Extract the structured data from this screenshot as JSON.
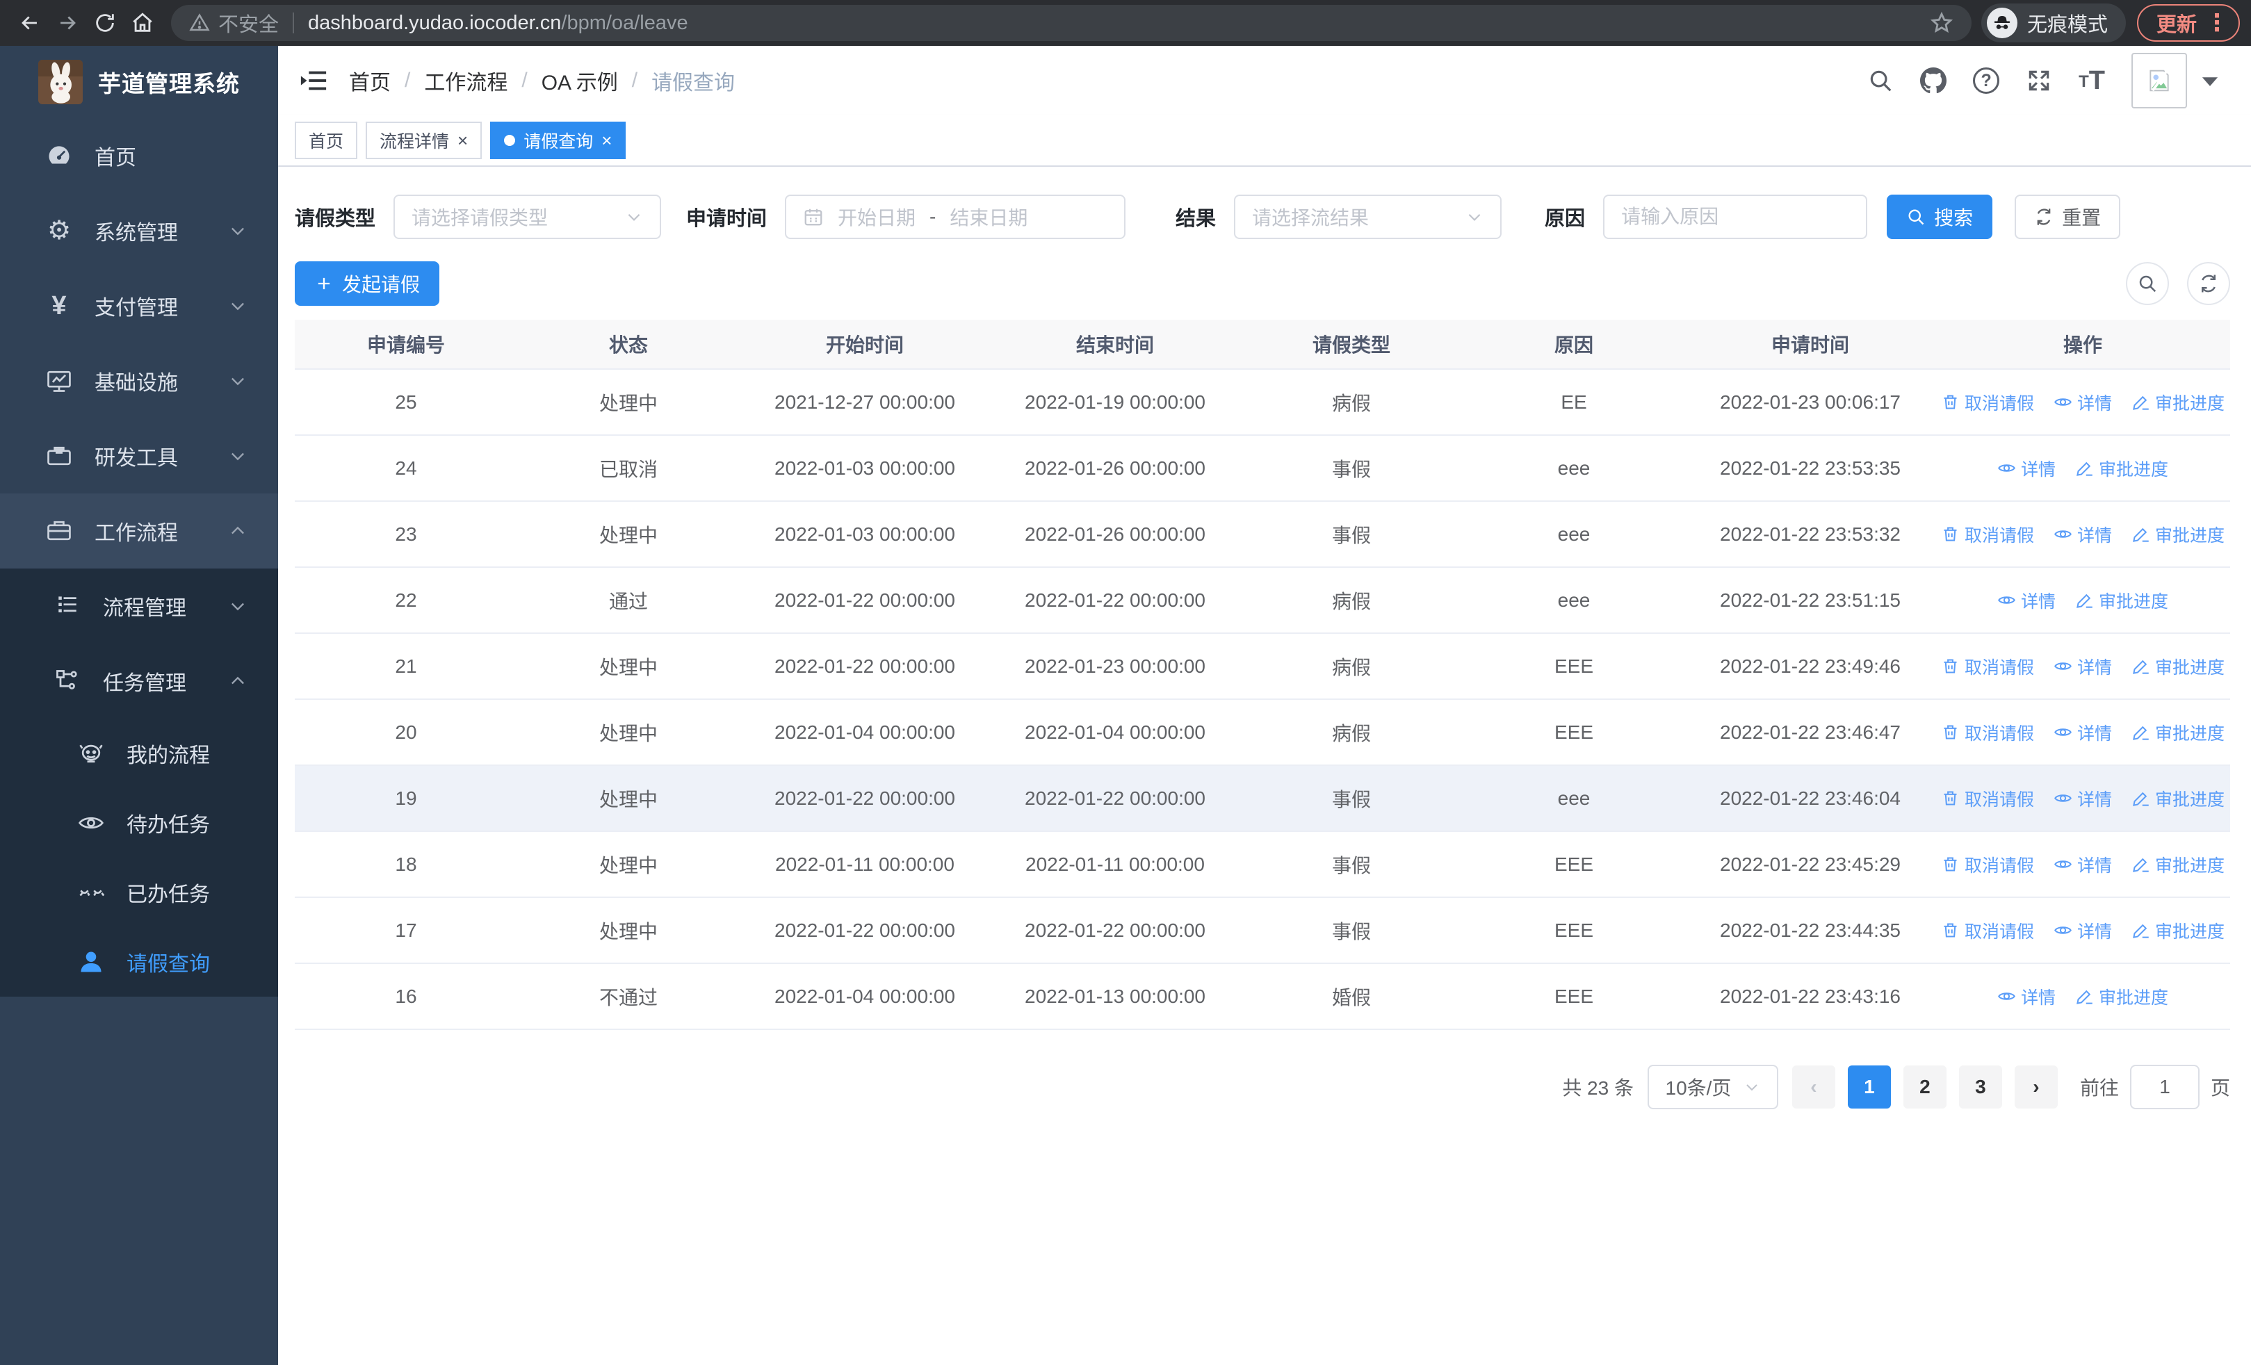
{
  "colors": {
    "accent": "#2d8cf0",
    "link": "#5b9df8",
    "sidebar_bg": "#304156",
    "submenu_bg": "#1f2d3d",
    "update_pill": "#f28b82",
    "table_header_bg": "#f8f8f9"
  },
  "browser": {
    "security": "不安全",
    "url_host": "dashboard.yudao.iocoder.cn",
    "url_path": "/bpm/oa/leave",
    "incognito": "无痕模式",
    "update": "更新"
  },
  "sidebar": {
    "title": "芋道管理系统",
    "items": [
      {
        "label": "首页"
      },
      {
        "label": "系统管理"
      },
      {
        "label": "支付管理"
      },
      {
        "label": "基础设施"
      },
      {
        "label": "研发工具"
      },
      {
        "label": "工作流程"
      }
    ],
    "sub": [
      {
        "label": "流程管理"
      },
      {
        "label": "任务管理"
      }
    ],
    "sub2": [
      {
        "label": "我的流程"
      },
      {
        "label": "待办任务"
      },
      {
        "label": "已办任务"
      },
      {
        "label": "请假查询"
      }
    ]
  },
  "breadcrumb": [
    "首页",
    "工作流程",
    "OA 示例",
    "请假查询"
  ],
  "tabs": [
    {
      "label": "首页"
    },
    {
      "label": "流程详情"
    },
    {
      "label": "请假查询"
    }
  ],
  "filters": {
    "leave_type_label": "请假类型",
    "leave_type_placeholder": "请选择请假类型",
    "apply_time_label": "申请时间",
    "date_start_placeholder": "开始日期",
    "date_separator": "-",
    "date_end_placeholder": "结束日期",
    "result_label": "结果",
    "result_placeholder": "请选择流结果",
    "reason_label": "原因",
    "reason_placeholder": "请输入原因",
    "search": "搜索",
    "reset": "重置"
  },
  "toolbar": {
    "create": "发起请假"
  },
  "table": {
    "headers": [
      "申请编号",
      "状态",
      "开始时间",
      "结束时间",
      "请假类型",
      "原因",
      "申请时间",
      "操作"
    ],
    "action_labels": {
      "cancel": "取消请假",
      "detail": "详情",
      "progress": "审批进度"
    },
    "rows": [
      {
        "id": "25",
        "status": "处理中",
        "start_time": "2021-12-27 00:00:00",
        "end_time": "2022-01-19 00:00:00",
        "leave_type": "病假",
        "reason": "EE",
        "apply_time": "2022-01-23 00:06:17",
        "actions": [
          "cancel",
          "detail",
          "progress"
        ],
        "highlighted": false
      },
      {
        "id": "24",
        "status": "已取消",
        "start_time": "2022-01-03 00:00:00",
        "end_time": "2022-01-26 00:00:00",
        "leave_type": "事假",
        "reason": "eee",
        "apply_time": "2022-01-22 23:53:35",
        "actions": [
          "detail",
          "progress"
        ],
        "highlighted": false
      },
      {
        "id": "23",
        "status": "处理中",
        "start_time": "2022-01-03 00:00:00",
        "end_time": "2022-01-26 00:00:00",
        "leave_type": "事假",
        "reason": "eee",
        "apply_time": "2022-01-22 23:53:32",
        "actions": [
          "cancel",
          "detail",
          "progress"
        ],
        "highlighted": false
      },
      {
        "id": "22",
        "status": "通过",
        "start_time": "2022-01-22 00:00:00",
        "end_time": "2022-01-22 00:00:00",
        "leave_type": "病假",
        "reason": "eee",
        "apply_time": "2022-01-22 23:51:15",
        "actions": [
          "detail",
          "progress"
        ],
        "highlighted": false
      },
      {
        "id": "21",
        "status": "处理中",
        "start_time": "2022-01-22 00:00:00",
        "end_time": "2022-01-23 00:00:00",
        "leave_type": "病假",
        "reason": "EEE",
        "apply_time": "2022-01-22 23:49:46",
        "actions": [
          "cancel",
          "detail",
          "progress"
        ],
        "highlighted": false
      },
      {
        "id": "20",
        "status": "处理中",
        "start_time": "2022-01-04 00:00:00",
        "end_time": "2022-01-04 00:00:00",
        "leave_type": "病假",
        "reason": "EEE",
        "apply_time": "2022-01-22 23:46:47",
        "actions": [
          "cancel",
          "detail",
          "progress"
        ],
        "highlighted": false
      },
      {
        "id": "19",
        "status": "处理中",
        "start_time": "2022-01-22 00:00:00",
        "end_time": "2022-01-22 00:00:00",
        "leave_type": "事假",
        "reason": "eee",
        "apply_time": "2022-01-22 23:46:04",
        "actions": [
          "cancel",
          "detail",
          "progress"
        ],
        "highlighted": true
      },
      {
        "id": "18",
        "status": "处理中",
        "start_time": "2022-01-11 00:00:00",
        "end_time": "2022-01-11 00:00:00",
        "leave_type": "事假",
        "reason": "EEE",
        "apply_time": "2022-01-22 23:45:29",
        "actions": [
          "cancel",
          "detail",
          "progress"
        ],
        "highlighted": false
      },
      {
        "id": "17",
        "status": "处理中",
        "start_time": "2022-01-22 00:00:00",
        "end_time": "2022-01-22 00:00:00",
        "leave_type": "事假",
        "reason": "EEE",
        "apply_time": "2022-01-22 23:44:35",
        "actions": [
          "cancel",
          "detail",
          "progress"
        ],
        "highlighted": false
      },
      {
        "id": "16",
        "status": "不通过",
        "start_time": "2022-01-04 00:00:00",
        "end_time": "2022-01-13 00:00:00",
        "leave_type": "婚假",
        "reason": "EEE",
        "apply_time": "2022-01-22 23:43:16",
        "actions": [
          "detail",
          "progress"
        ],
        "highlighted": false
      }
    ]
  },
  "pagination": {
    "total": "共 23 条",
    "page_size": "10条/页",
    "pages": [
      "1",
      "2",
      "3"
    ],
    "active_page": "1",
    "goto_label": "前往",
    "goto_value": "1",
    "unit_label": "页"
  }
}
